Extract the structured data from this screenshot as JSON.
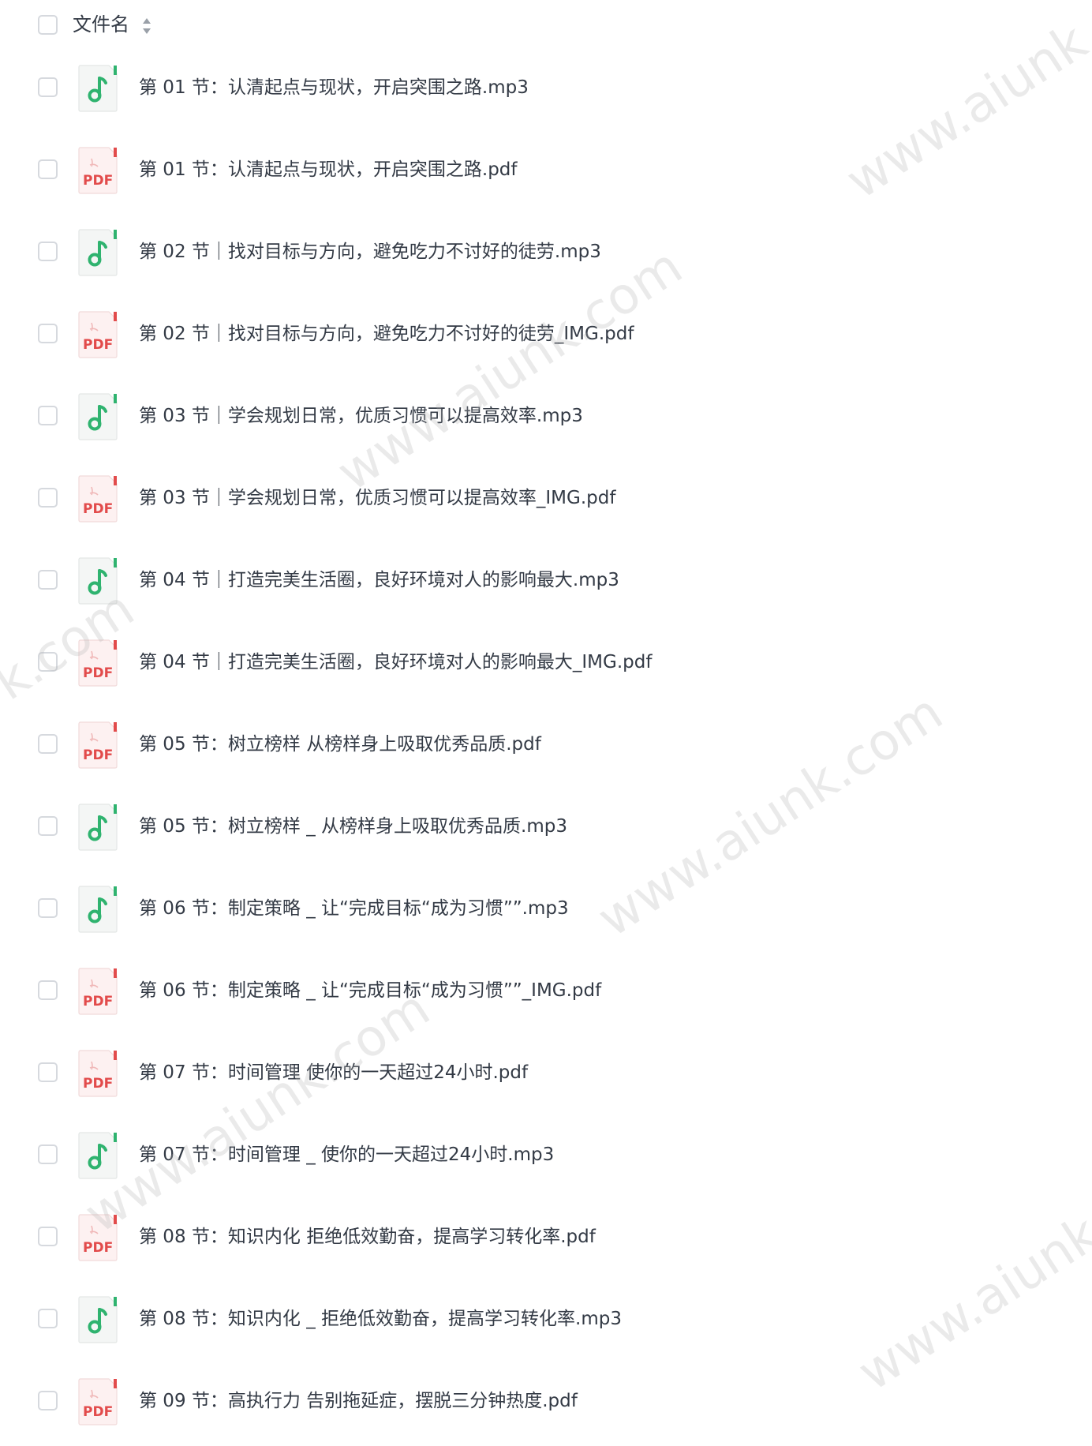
{
  "header": {
    "column_label": "文件名",
    "sort_icon": "sort-updown-icon"
  },
  "colors": {
    "audio_accent": "#2fb36f",
    "pdf_accent": "#e24b4b",
    "icon_bg": "#f4f6f5",
    "pdf_bg": "#fdf1f1",
    "checkbox_border": "#d6d9de",
    "watermark": "#b4b4b4"
  },
  "files": [
    {
      "name": "第 01 节：认清起点与现状，开启突围之路.mp3",
      "type": "audio",
      "icon": "music-note-icon"
    },
    {
      "name": "第 01 节：认清起点与现状，开启突围之路.pdf",
      "type": "pdf",
      "icon": "pdf-file-icon"
    },
    {
      "name": "第 02 节｜找对目标与方向，避免吃力不讨好的徒劳.mp3",
      "type": "audio",
      "icon": "music-note-icon"
    },
    {
      "name": "第 02 节｜找对目标与方向，避免吃力不讨好的徒劳_IMG.pdf",
      "type": "pdf",
      "icon": "pdf-file-icon"
    },
    {
      "name": "第 03 节｜学会规划日常，优质习惯可以提高效率.mp3",
      "type": "audio",
      "icon": "music-note-icon"
    },
    {
      "name": "第 03 节｜学会规划日常，优质习惯可以提高效率_IMG.pdf",
      "type": "pdf",
      "icon": "pdf-file-icon"
    },
    {
      "name": "第 04 节｜打造完美生活圈，良好环境对人的影响最大.mp3",
      "type": "audio",
      "icon": "music-note-icon"
    },
    {
      "name": "第 04 节｜打造完美生活圈，良好环境对人的影响最大_IMG.pdf",
      "type": "pdf",
      "icon": "pdf-file-icon"
    },
    {
      "name": "第 05 节：树立榜样 从榜样身上吸取优秀品质.pdf",
      "type": "pdf",
      "icon": "pdf-file-icon"
    },
    {
      "name": "第 05 节：树立榜样 _ 从榜样身上吸取优秀品质.mp3",
      "type": "audio",
      "icon": "music-note-icon"
    },
    {
      "name": "第 06 节：制定策略 _ 让“完成目标“成为习惯””.mp3",
      "type": "audio",
      "icon": "music-note-icon"
    },
    {
      "name": "第 06 节：制定策略 _ 让“完成目标“成为习惯””_IMG.pdf",
      "type": "pdf",
      "icon": "pdf-file-icon"
    },
    {
      "name": "第 07 节：时间管理 使你的一天超过24小时.pdf",
      "type": "pdf",
      "icon": "pdf-file-icon"
    },
    {
      "name": "第 07 节：时间管理 _ 使你的一天超过24小时.mp3",
      "type": "audio",
      "icon": "music-note-icon"
    },
    {
      "name": "第 08 节：知识内化 拒绝低效勤奋，提高学习转化率.pdf",
      "type": "pdf",
      "icon": "pdf-file-icon"
    },
    {
      "name": "第 08 节：知识内化 _ 拒绝低效勤奋，提高学习转化率.mp3",
      "type": "audio",
      "icon": "music-note-icon"
    },
    {
      "name": "第 09 节：高执行力 告别拖延症，摆脱三分钟热度.pdf",
      "type": "pdf",
      "icon": "pdf-file-icon"
    }
  ],
  "watermarks": [
    "www.aiunk.com",
    "www.aiunk.com",
    "www.aiunk.com",
    "www.aiunk.com",
    "www.aiunk.com",
    "k.com"
  ]
}
